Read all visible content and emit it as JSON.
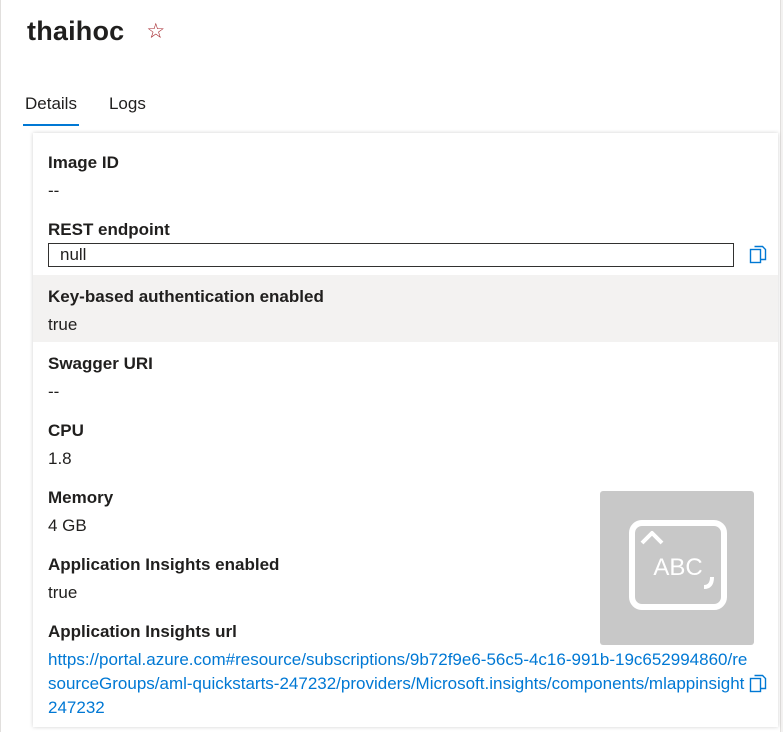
{
  "header": {
    "title": "thaihoc",
    "star_icon": "star-outline-icon"
  },
  "tabs": [
    {
      "label": "Details",
      "active": true
    },
    {
      "label": "Logs",
      "active": false
    }
  ],
  "details": {
    "image_id": {
      "label": "Image ID",
      "value": "--"
    },
    "rest_endpoint": {
      "label": "REST endpoint",
      "value": "null"
    },
    "key_auth": {
      "label": "Key-based authentication enabled",
      "value": "true"
    },
    "swagger_uri": {
      "label": "Swagger URI",
      "value": "--"
    },
    "cpu": {
      "label": "CPU",
      "value": "1.8"
    },
    "memory": {
      "label": "Memory",
      "value": "4 GB"
    },
    "app_insights_enabled": {
      "label": "Application Insights enabled",
      "value": "true"
    },
    "app_insights_url": {
      "label": "Application Insights url",
      "value": "https://portal.azure.com#resource/subscriptions/9b72f9e6-56c5-4c16-991b-19c652994860/resourceGroups/aml-quickstarts-247232/providers/Microsoft.insights/components/mlappinsight247232"
    }
  },
  "overlay": {
    "text": "ABC",
    "icon": "keyboard-abc-icon"
  },
  "colors": {
    "accent": "#0078d4",
    "star": "#a4262c",
    "highlight_row": "#f3f2f1"
  }
}
